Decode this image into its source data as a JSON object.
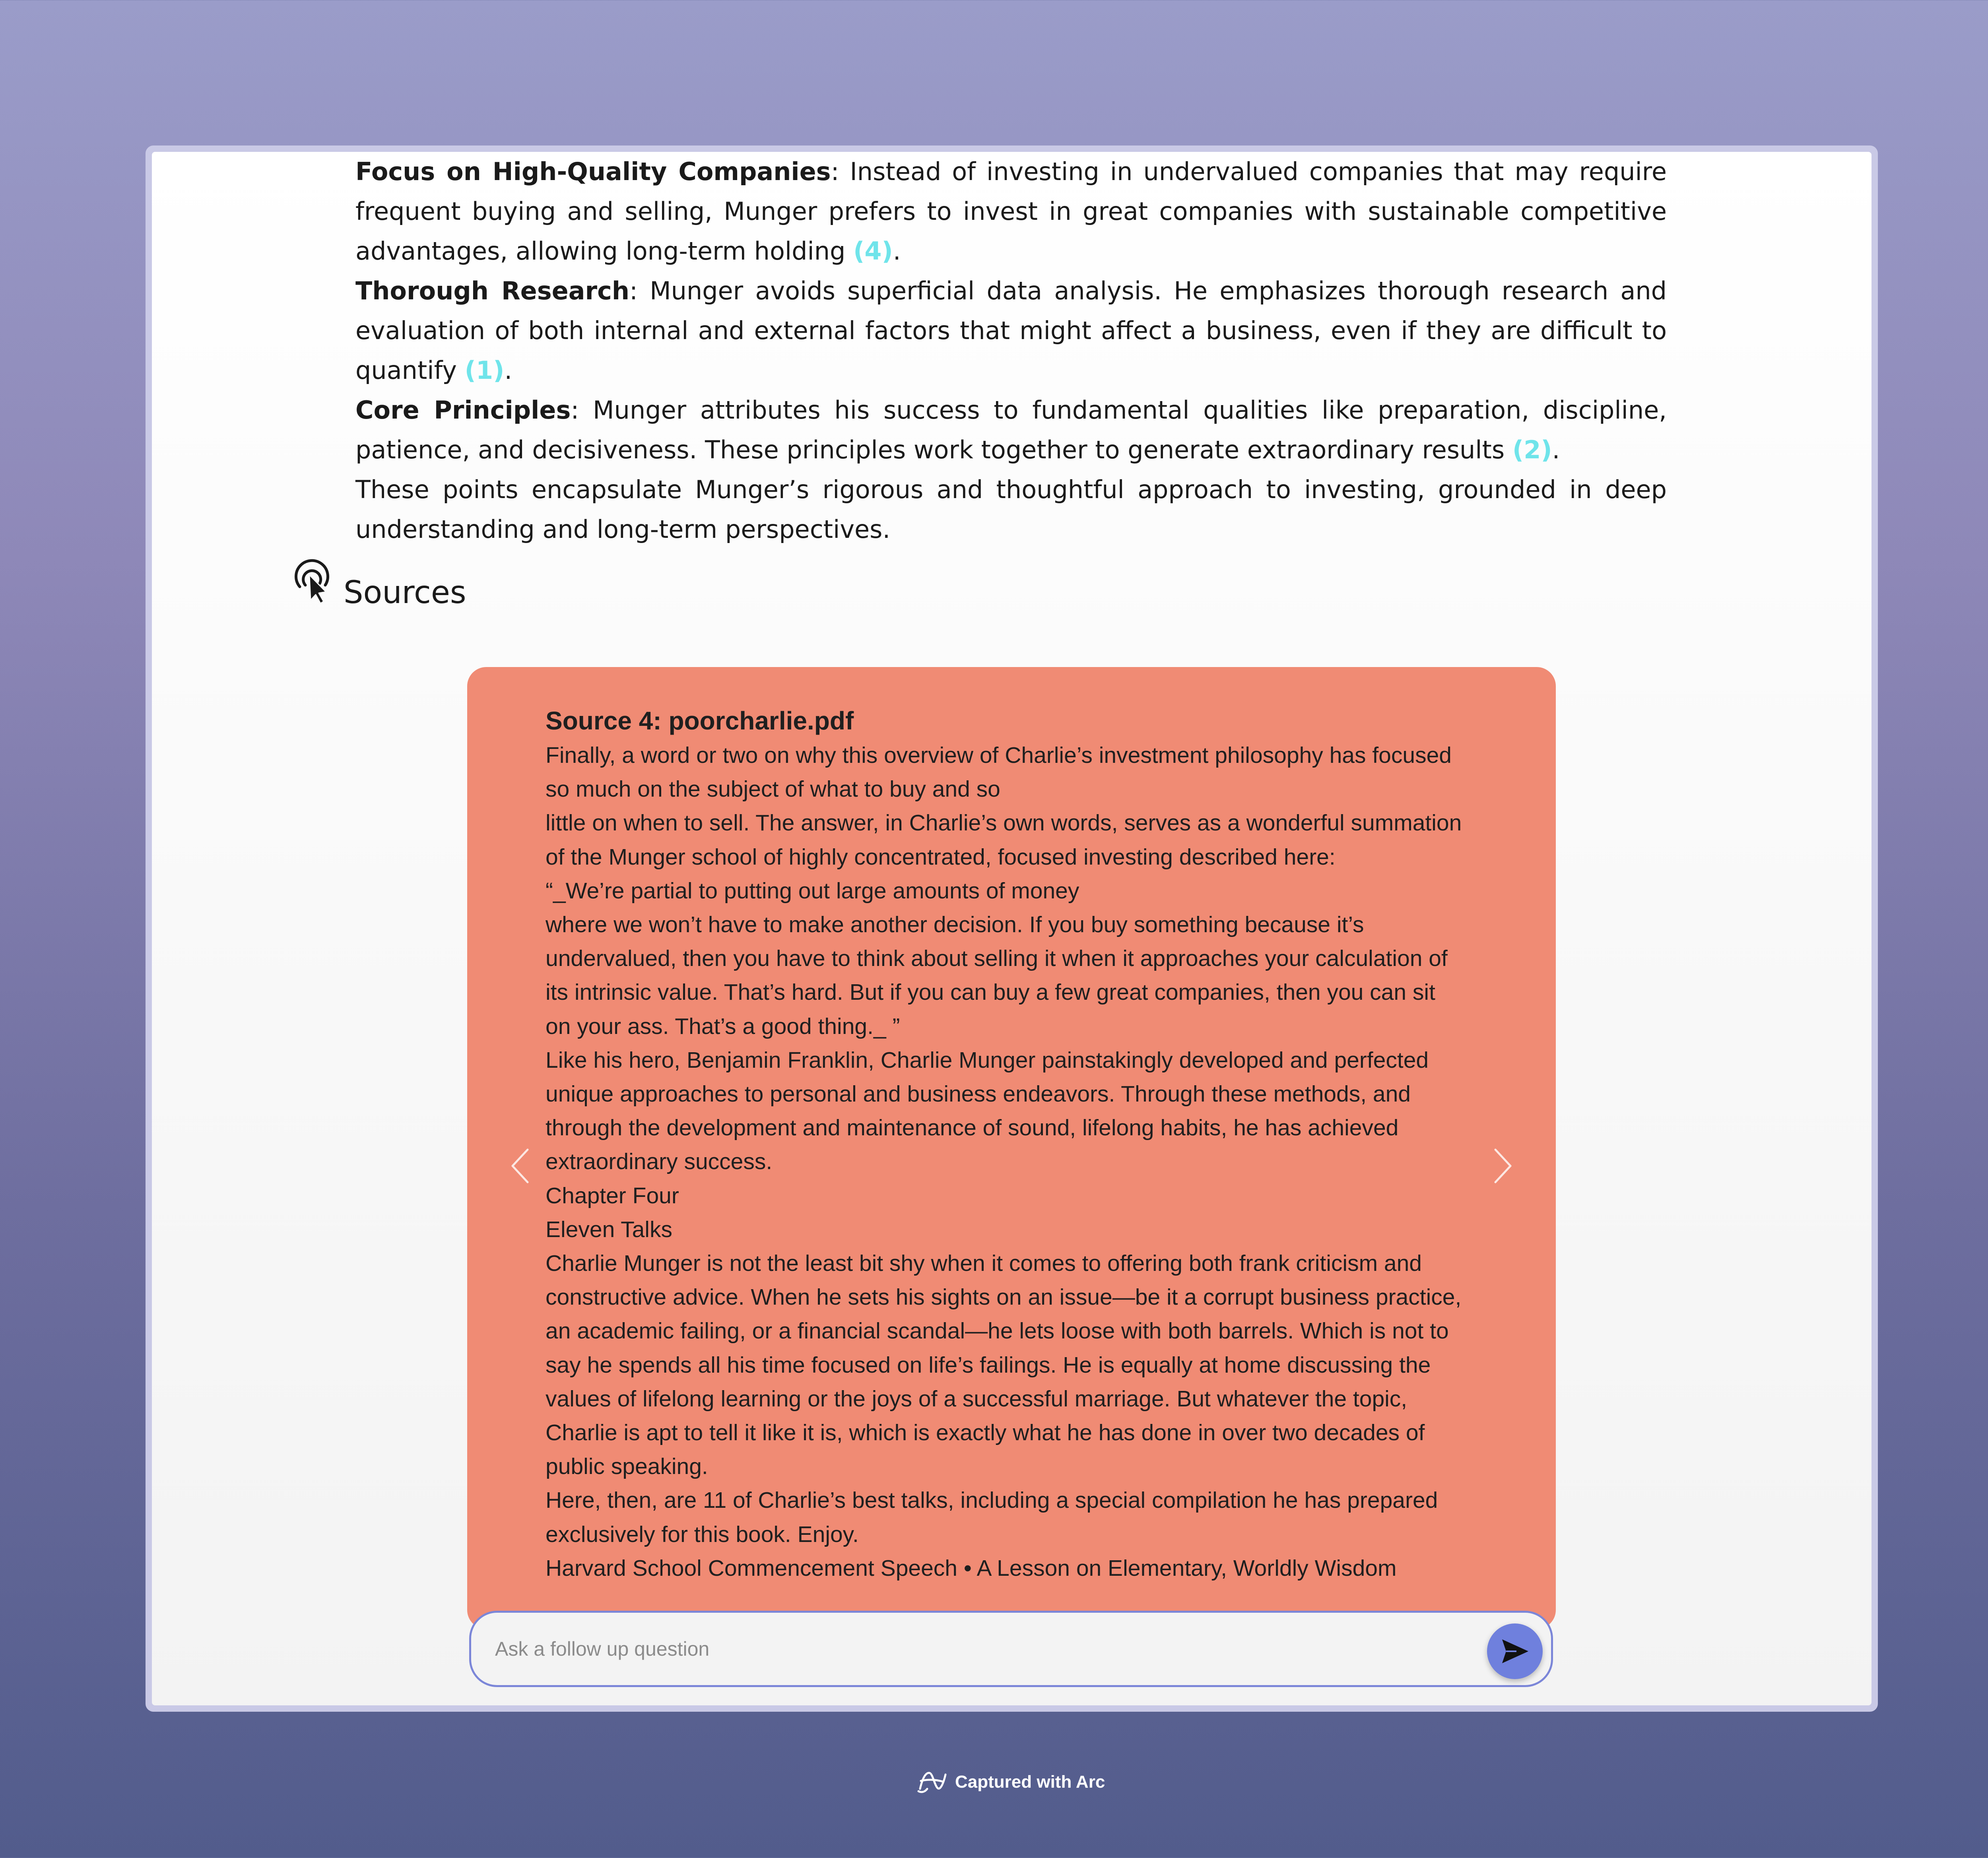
{
  "answer": {
    "points": [
      {
        "title": "Focus on High-Quality Companies",
        "text": ": Instead of investing in undervalued companies that may require frequent buying and selling, Munger prefers to invest in great companies with sustainable competitive advantages, allowing long-term holding ",
        "citation": "(4)",
        "end": "."
      },
      {
        "title": "Thorough Research",
        "text": ": Munger avoids superficial data analysis. He emphasizes thorough research and evaluation of both internal and external factors that might affect a business, even if they are difficult to quantify ",
        "citation": "(1)",
        "end": "."
      },
      {
        "title": "Core Principles",
        "text": ": Munger attributes his success to fundamental qualities like preparation, discipline, patience, and decisiveness. These principles work together to generate extraordinary results ",
        "citation": "(2)",
        "end": "."
      }
    ],
    "summary": "These points encapsulate Munger’s rigorous and thoughtful approach to investing, grounded in deep understanding and long-term perspectives."
  },
  "sources": {
    "heading": "Sources",
    "icon": "pointer-click-icon",
    "card_color": "#f08b74",
    "card_title": "Source 4: poorcharlie.pdf",
    "lines": [
      "Finally, a word or two on why this overview of Charlie’s investment philosophy has focused",
      "so much on the subject of what to buy and so",
      "little on when to sell. The answer, in Charlie’s own words, serves as a wonderful summation",
      "of the Munger school of highly concentrated, focused investing described here:",
      "“_We’re partial to putting out large amounts of money",
      "where we won’t have to make another decision. If you buy something because it’s",
      "undervalued, then you have to think about selling it when it approaches your calculation of",
      "its intrinsic value. That’s hard. But if you can buy a few great companies, then you can sit",
      "on your ass. That’s a good thing._ ”",
      "Like his hero, Benjamin Franklin, Charlie Munger painstakingly developed and perfected",
      "unique approaches to personal and business endeavors. Through these methods, and",
      "through the development and maintenance of sound, lifelong habits, he has achieved",
      "extraordinary success.",
      "Chapter Four",
      "Eleven Talks",
      "Charlie Munger is not the least bit shy when it comes to offering both frank criticism and",
      "constructive advice. When he sets his sights on an issue—be it a corrupt business practice,",
      "an academic failing, or a financial scandal—he lets loose with both barrels. Which is not to",
      "say he spends all his time focused on life’s failings. He is equally at home discussing the",
      "values of lifelong learning or the joys of a successful marriage. But whatever the topic,",
      "Charlie is apt to tell it like it is, which is exactly what he has done in over two decades of",
      "public speaking.",
      "Here, then, are 11 of Charlie’s best talks, including a special compilation he has prepared",
      "exclusively for this book. Enjoy.",
      "Harvard School Commencement Speech • A Lesson on Elementary, Worldly Wisdom"
    ],
    "prev_icon": "chevron-left-icon",
    "next_icon": "chevron-right-icon"
  },
  "followup": {
    "placeholder": "Ask a follow up question",
    "value": "",
    "send_icon": "send-icon",
    "accent": "#6f80dd"
  },
  "footer": {
    "label": "Captured with Arc",
    "icon": "arc-logo-icon"
  },
  "colors": {
    "citation": "#6fe4ea",
    "card": "#f08b74",
    "accent": "#7b86d8"
  }
}
